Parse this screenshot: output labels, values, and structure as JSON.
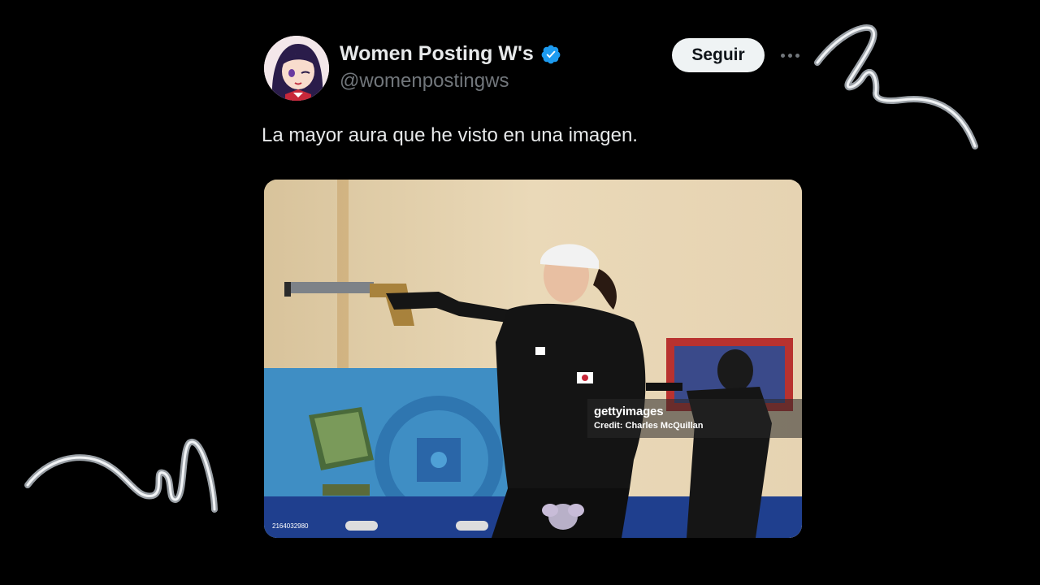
{
  "tweet": {
    "author": {
      "display_name": "Women Posting W's",
      "handle": "@womenpostingws",
      "verified": true,
      "avatar_icon": "anime-avatar-icon"
    },
    "follow_label": "Seguir",
    "more_icon": "more-options-icon",
    "text": "La mayor aura que he visto en una imagen.",
    "media": {
      "watermark_brand": "gettyimages",
      "watermark_credit": "Credit: Charles McQuillan",
      "image_id": "2164032980"
    }
  },
  "colors": {
    "background": "#000000",
    "text_primary": "#e7e9ea",
    "text_secondary": "#71767b",
    "verified_blue": "#1d9bf0",
    "follow_button_bg": "#eff3f4"
  }
}
